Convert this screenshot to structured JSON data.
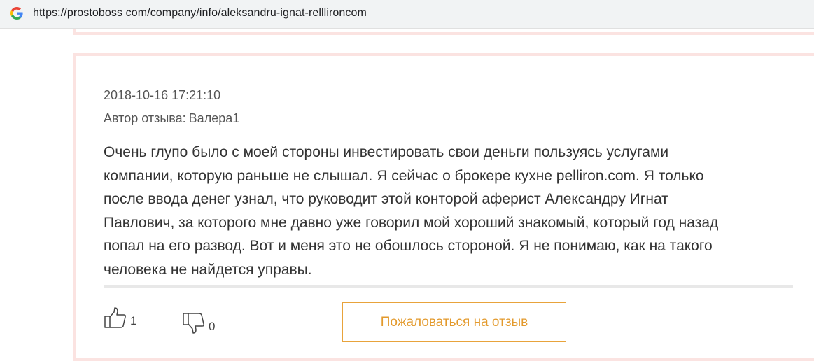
{
  "browser": {
    "url": "https://prostoboss com/company/info/aleksandru-ignat-relllironcom",
    "favicon": "google-g-icon"
  },
  "review": {
    "date": "2018-10-16 17:21:10",
    "author_label": "Автор отзыва:",
    "author_name": "Валера1",
    "text_lines": [
      "Очень глупо было с моей стороны инвестировать свои деньги пользуясь услугами",
      "компании, которую раньше не слышал. Я сейчас о брокере кухне pelliron.com. Я только",
      "после ввода денег узнал, что руководит этой конторой аферист Александру Игнат",
      "Павлович, за которого мне давно уже говорил мой хороший знакомый, который год назад",
      "попал на его развод. Вот и меня это не обошлось стороной. Я не понимаю, как на такого",
      "человека не найдется управы."
    ],
    "likes": "1",
    "dislikes": "0",
    "complain_label": "Пожаловаться на отзыв"
  },
  "colors": {
    "card_border": "#fbe3e1",
    "accent": "#e39a2d",
    "text": "#333333",
    "meta_text": "#555555"
  },
  "icons": {
    "like": "thumbs-up-icon",
    "dislike": "thumbs-down-icon"
  }
}
